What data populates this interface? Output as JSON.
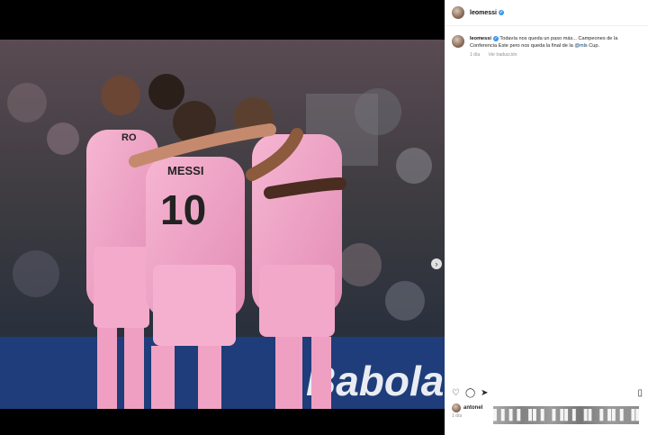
{
  "post": {
    "username": "leomessi",
    "caption_text": "Todavía nos queda un paso más... Campeones de la Conferencia Este pero nos queda la final de la ",
    "caption_mention": "@mls",
    "caption_end": " Cup.",
    "time_ago": "1 día",
    "translation_link": "Ver traducción"
  },
  "photo": {
    "jersey_name": "MESSI",
    "jersey_number": "10",
    "jersey_name_2": "RO",
    "banner_text": "Babolat"
  },
  "likes": {
    "liker": "antonel",
    "time": "1 día"
  },
  "watermark": "▌▌▌▌▐▌▌▐▐▌▌▐▌▐▐▌▌▐▌▐▐▌▌",
  "icons": {
    "verified": "verified-badge-icon",
    "like": "heart-icon",
    "comment": "comment-icon",
    "share": "send-icon",
    "save": "bookmark-icon",
    "next": "chevron-right-icon"
  },
  "colors": {
    "jersey_pink": "#f2a2c6",
    "background": "#000000",
    "link": "#00376b",
    "verified": "#3897f0"
  }
}
